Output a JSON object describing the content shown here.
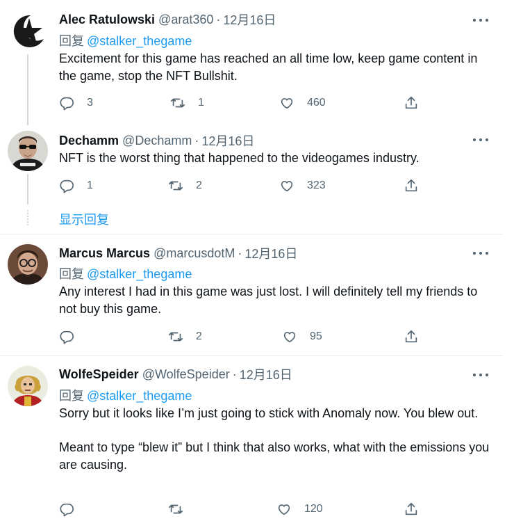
{
  "tweets": [
    {
      "name": "Alec Ratulowski",
      "handle": "@arat360",
      "time": "12月16日",
      "reply_prefix": "回复",
      "reply_to": "@stalker_thegame",
      "paragraphs": [
        "Excitement for this game has reached an all time low, keep game content in the game, stop the NFT Bullshit."
      ],
      "replies": "3",
      "retweets": "1",
      "likes": "460",
      "avatar_icon": "star-logo-icon"
    },
    {
      "name": "Dechamm",
      "handle": "@Dechamm",
      "time": "12月16日",
      "paragraphs": [
        "NFT is the worst thing that happened to the videogames industry."
      ],
      "replies": "1",
      "retweets": "2",
      "likes": "323",
      "avatar_icon": "sunglasses-man-icon"
    },
    {
      "name": "Marcus Marcus",
      "handle": "@marcusdotM",
      "time": "12月16日",
      "reply_prefix": "回复",
      "reply_to": "@stalker_thegame",
      "paragraphs": [
        "Any interest I had in this game was just lost. I will definitely tell my friends to not buy this game."
      ],
      "replies": "",
      "retweets": "2",
      "likes": "95",
      "avatar_icon": "glasses-man-icon"
    },
    {
      "name": "WolfeSpeider",
      "handle": "@WolfeSpeider",
      "time": "12月16日",
      "reply_prefix": "回复",
      "reply_to": "@stalker_thegame",
      "paragraphs": [
        "Sorry but it looks like I’m just going to stick with Anomaly now. You blew out.",
        "Meant to type “blew it” but I think that also works, what with the emissions you are causing."
      ],
      "replies": "",
      "retweets": "",
      "likes": "120",
      "avatar_icon": "pixel-character-icon"
    }
  ],
  "show_replies": "显示回复",
  "colors": {
    "accent": "#1d9bf0",
    "text": "#0f1419",
    "muted": "#536471",
    "divider": "#e6ecf0"
  }
}
